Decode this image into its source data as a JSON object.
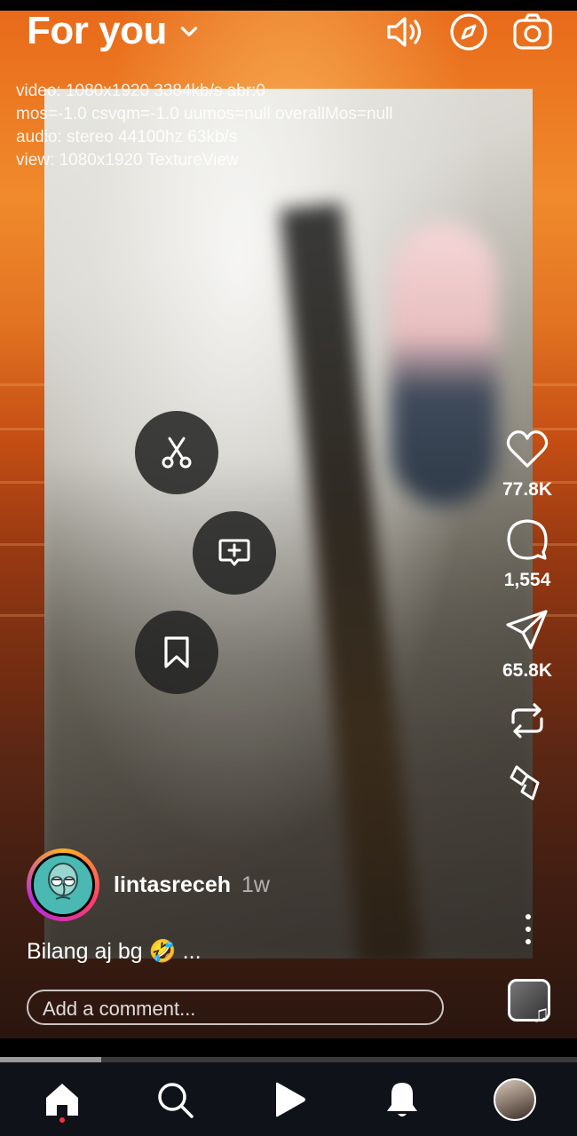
{
  "header": {
    "title": "For you",
    "icons": [
      "chevron-down-icon",
      "speaker-icon",
      "compass-icon",
      "camera-icon"
    ]
  },
  "debug_overlay": {
    "lines": [
      "video: 1080x1920 3384kb/s abr:0",
      "mos=-1.0 csvqm=-1.0 uumos=null overallMos=null",
      "audio: stereo 44100hz 63kb/s",
      "view: 1080x1920 TextureView"
    ]
  },
  "floating_actions": [
    "scissors-icon",
    "add-comment-icon",
    "bookmark-icon"
  ],
  "actions": {
    "likes": "77.8K",
    "comments": "1,554",
    "shares": "65.8K",
    "icons": [
      "heart-icon",
      "comment-icon",
      "send-icon",
      "repost-icon",
      "remix-icon",
      "more-icon"
    ]
  },
  "post": {
    "username": "lintasreceh",
    "time": "1w",
    "caption": "Bilang aj bg 🤣 ..."
  },
  "comment": {
    "placeholder": "Add a comment..."
  },
  "playback": {
    "progress": 0.175
  },
  "bottom_nav": {
    "items": [
      "home-icon",
      "search-icon",
      "reels-icon",
      "notifications-icon",
      "profile-avatar"
    ],
    "active": "home-icon"
  },
  "colors": {
    "notification_dot": "#ff2d3f",
    "nav_background": "#0f1218"
  }
}
